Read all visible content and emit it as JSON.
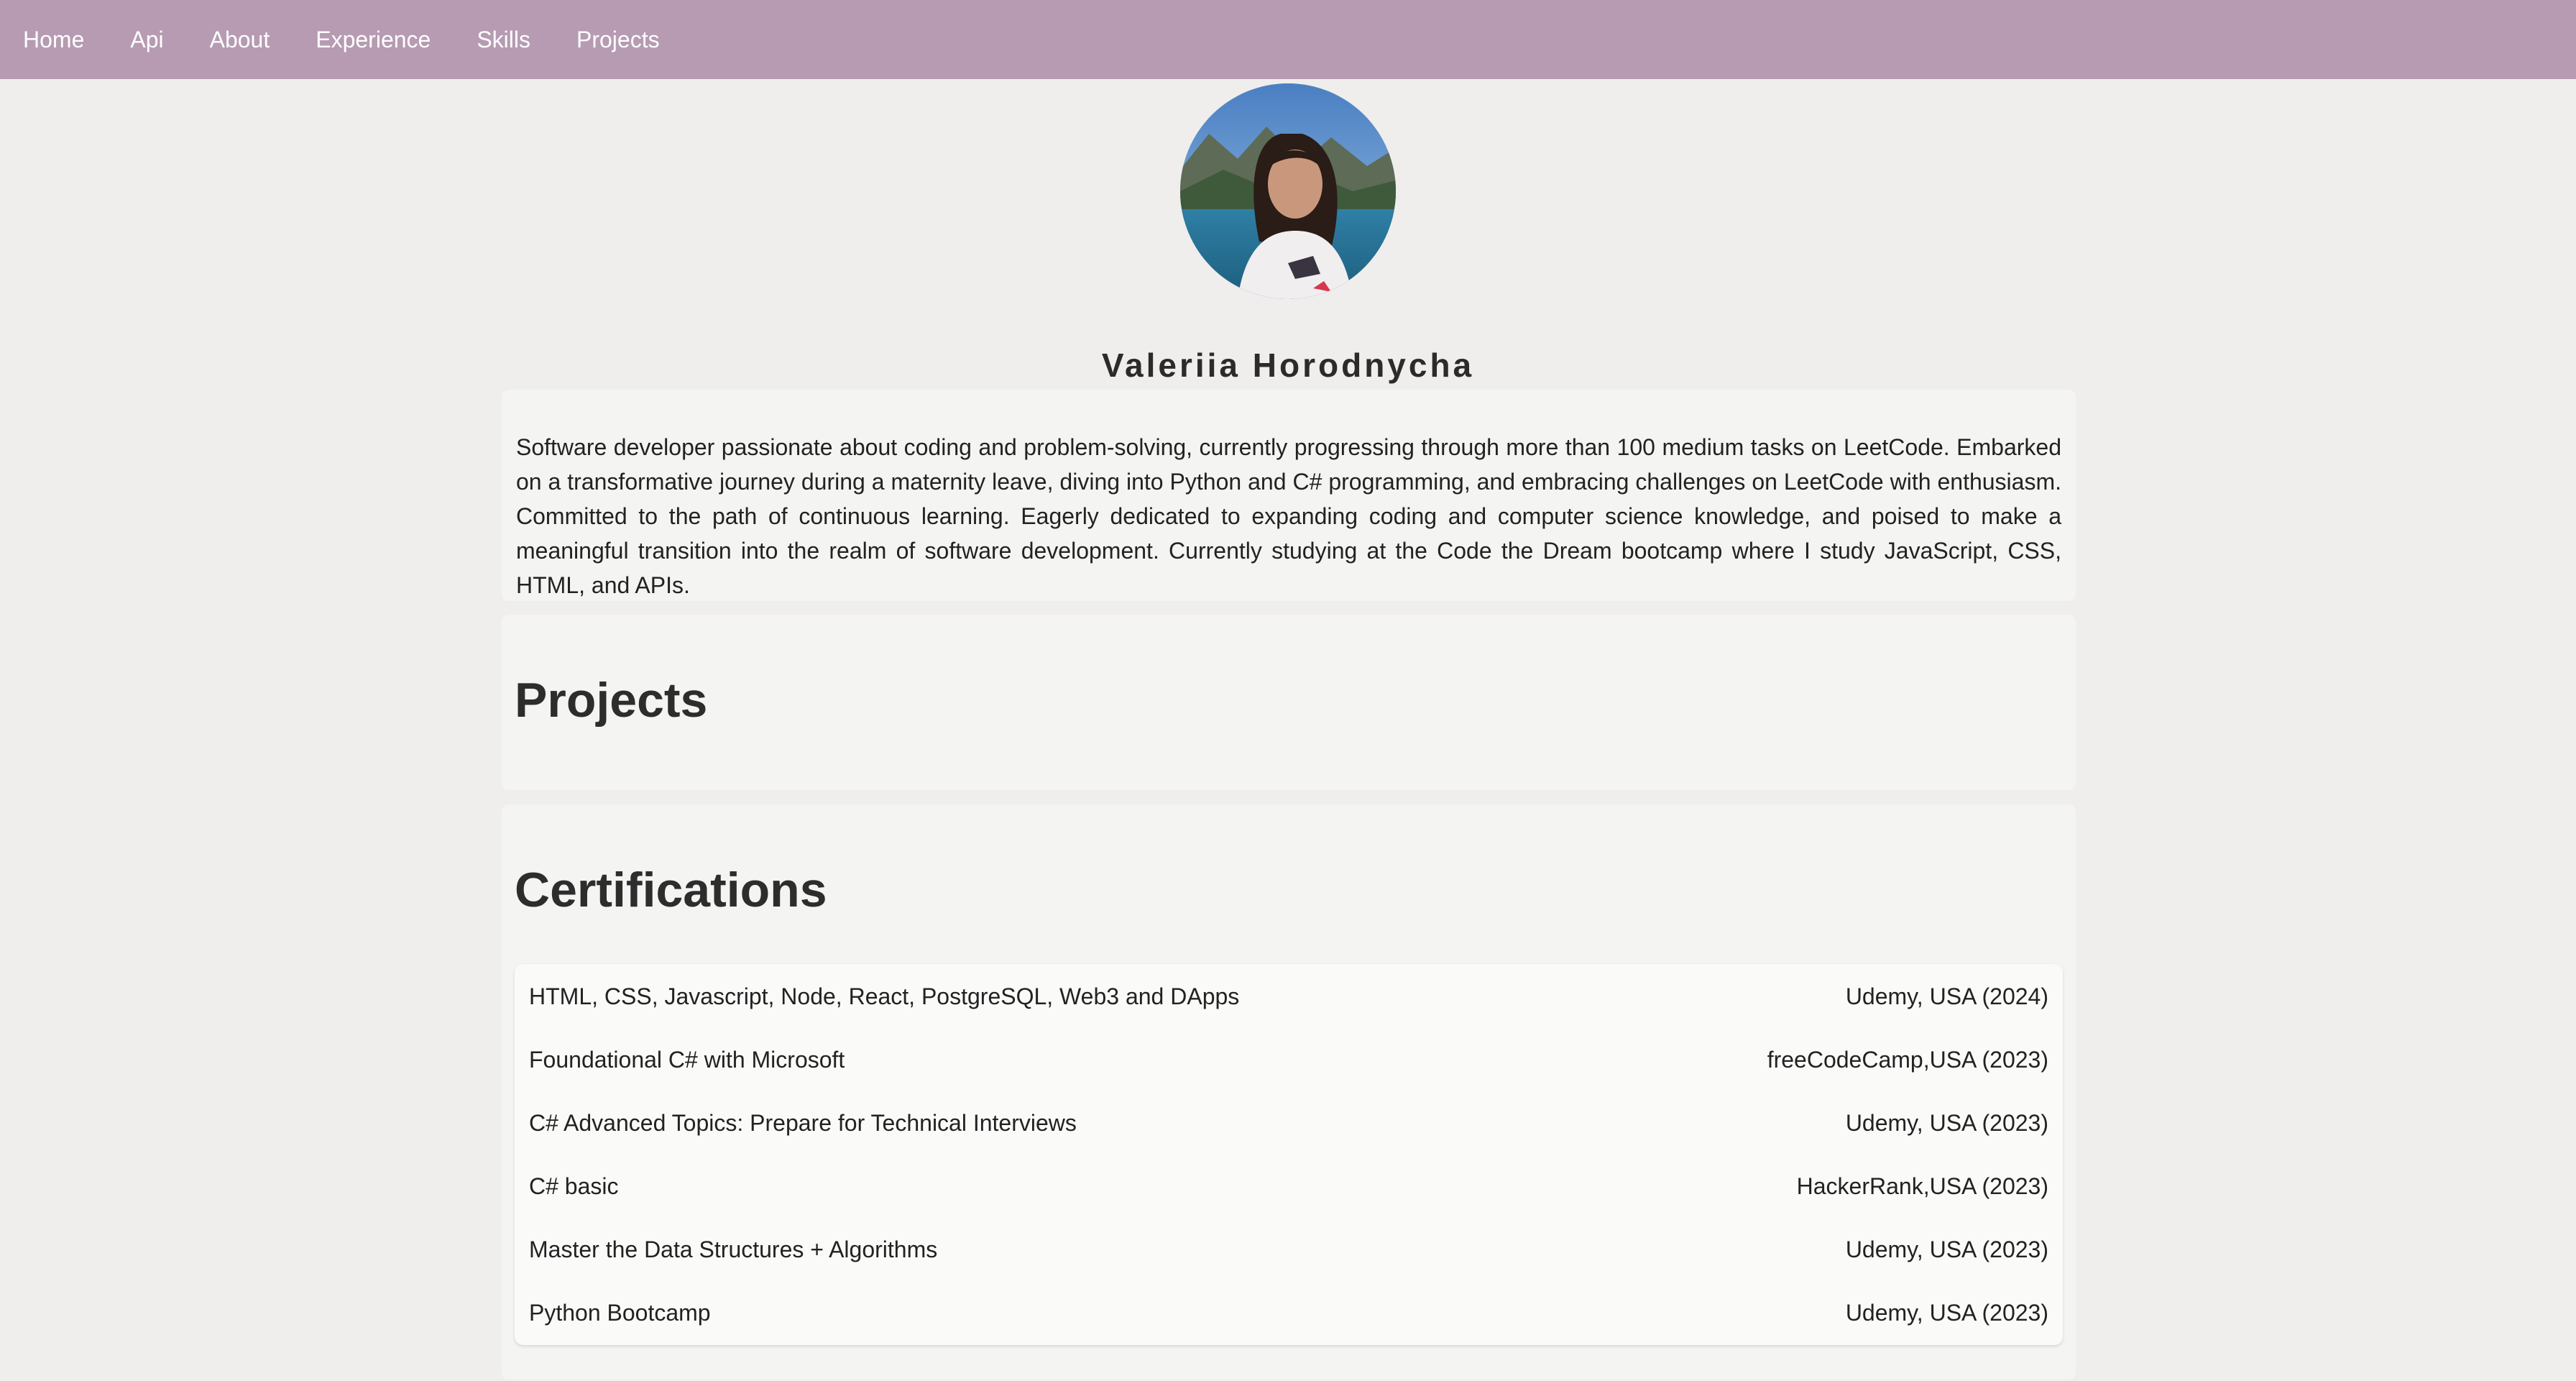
{
  "nav": {
    "items": [
      {
        "label": "Home"
      },
      {
        "label": "Api"
      },
      {
        "label": "About"
      },
      {
        "label": "Experience"
      },
      {
        "label": "Skills"
      },
      {
        "label": "Projects"
      }
    ]
  },
  "profile": {
    "name": "Valeriia Horodnycha",
    "avatar_icon": "profile-photo",
    "bio": "Software developer passionate about coding and problem-solving, currently progressing through more than 100 medium tasks on LeetCode. Embarked on a transformative journey during a maternity leave, diving into Python and C# programming, and embracing challenges on LeetCode with enthusiasm. Committed to the path of continuous learning. Eagerly dedicated to expanding coding and computer science knowledge, and poised to make a meaningful transition into the realm of software development. Currently studying at the Code the Dream bootcamp where I study JavaScript, CSS, HTML, and APIs."
  },
  "projects": {
    "title": "Projects"
  },
  "certifications": {
    "title": "Certifications",
    "items": [
      {
        "title": "HTML, CSS, Javascript, Node, React, PostgreSQL, Web3 and DApps",
        "issuer": "Udemy, USA (2024)"
      },
      {
        "title": "Foundational C# with Microsoft",
        "issuer": "freeCodeCamp,USA (2023)"
      },
      {
        "title": "C# Advanced Topics: Prepare for Technical Interviews",
        "issuer": "Udemy, USA (2023)"
      },
      {
        "title": "C# basic",
        "issuer": "HackerRank,USA (2023)"
      },
      {
        "title": "Master the Data Structures + Algorithms",
        "issuer": "Udemy, USA (2023)"
      },
      {
        "title": "Python Bootcamp",
        "issuer": "Udemy, USA (2023)"
      }
    ]
  },
  "colors": {
    "navbar": "#b69bb2",
    "background": "#efeeec",
    "card": "#f4f4f2"
  }
}
